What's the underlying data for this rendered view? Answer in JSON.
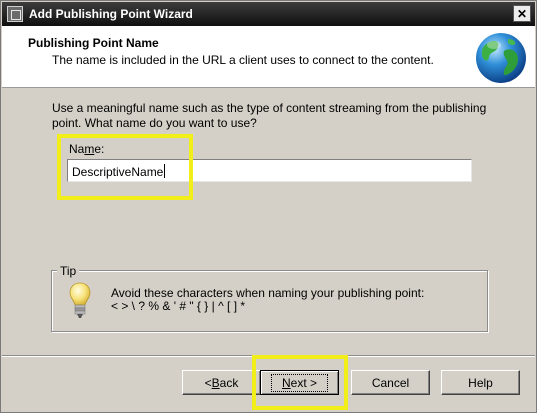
{
  "window": {
    "title": "Add Publishing Point Wizard",
    "close_glyph": "✕"
  },
  "header": {
    "title": "Publishing Point Name",
    "subtitle": "The name is included in the URL a client uses to connect to the content.",
    "icon": "globe-icon"
  },
  "body": {
    "prompt_line1": "Use a meaningful name such as the type of content streaming from the publishing",
    "prompt_line2": "point. What name do you want to use?",
    "name_label_pre": "Na",
    "name_label_accel": "m",
    "name_label_post": "e:",
    "name_value": "DescriptiveName"
  },
  "tip": {
    "legend": "Tip",
    "line1": "Avoid these characters when naming your publishing point:",
    "line2": "< > \\ ? % & ' # \" { } | ^ [ ] *",
    "icon": "lightbulb-icon"
  },
  "buttons": {
    "back_accel": "B",
    "back_rest": "ack",
    "back_prefix": "< ",
    "next_accel": "N",
    "next_rest": "ext >",
    "cancel": "Cancel",
    "help": "Help"
  },
  "colors": {
    "highlight": "#f2ee1a",
    "dialog_bg": "#d4d0c8",
    "titlebar": "#1a1a1a"
  }
}
